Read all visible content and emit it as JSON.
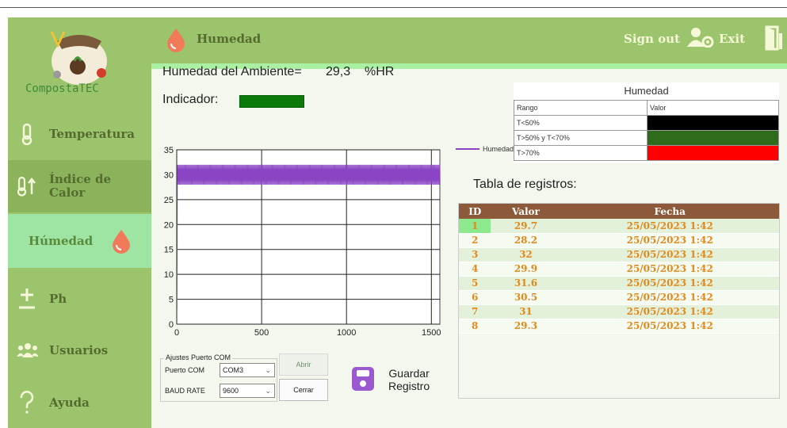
{
  "app": {
    "name": "CompostaTEC"
  },
  "header": {
    "title": "Humedad",
    "sign_out": "Sign out",
    "exit": "Exit"
  },
  "sidebar": {
    "items": [
      {
        "label": "Temperatura",
        "icon": "thermometer-icon"
      },
      {
        "label": "Índice de Calor",
        "line1": "Índice de",
        "line2": "Calor",
        "icon": "heat-index-icon"
      },
      {
        "label": "Húmedad",
        "icon": "water-drop-icon"
      },
      {
        "label": "Ph",
        "icon": "plus-minus-icon"
      },
      {
        "label": "Usuarios",
        "icon": "users-icon"
      },
      {
        "label": "Ayuda",
        "icon": "question-icon"
      }
    ]
  },
  "main": {
    "humidity_label": "Humedad del Ambiente=",
    "humidity_value": "29,3",
    "humidity_unit": "%HR",
    "indicator_label": "Indicador:",
    "indicator_color": "#0b7a0b"
  },
  "reference": {
    "title": "Humedad",
    "headers": [
      "Rango",
      "Valor"
    ],
    "rows": [
      {
        "range": "T<50%",
        "color": "#000000"
      },
      {
        "range": "T>50% y T<70%",
        "color": "#2e6b1a"
      },
      {
        "range": "T>70%",
        "color": "#ff0000"
      }
    ]
  },
  "chart_data": {
    "type": "line",
    "series": [
      {
        "name": "Humedad",
        "color": "#8a44c4"
      }
    ],
    "xlim": [
      0,
      1550
    ],
    "ylim": [
      0,
      35
    ],
    "xticks": [
      "0",
      "500",
      "1000",
      "1500"
    ],
    "yticks": [
      "0",
      "5",
      "10",
      "15",
      "20",
      "25",
      "30",
      "35"
    ],
    "grid": true,
    "legend": "right",
    "oscillation_range": [
      28,
      32
    ]
  },
  "records": {
    "title": "Tabla de registros:",
    "headers": [
      "ID",
      "Valor",
      "Fecha"
    ],
    "rows": [
      [
        "1",
        "29.7",
        "25/05/2023 1:42"
      ],
      [
        "2",
        "28.2",
        "25/05/2023 1:42"
      ],
      [
        "3",
        "32",
        "25/05/2023 1:42"
      ],
      [
        "4",
        "29.9",
        "25/05/2023 1:42"
      ],
      [
        "5",
        "31.6",
        "25/05/2023 1:42"
      ],
      [
        "6",
        "30.5",
        "25/05/2023 1:42"
      ],
      [
        "7",
        "31",
        "25/05/2023 1:42"
      ],
      [
        "8",
        "29.3",
        "25/05/2023 1:42"
      ]
    ]
  },
  "com": {
    "title": "Ajustes Puerto COM",
    "port_label": "Puerto COM",
    "port_value": "COM3",
    "baud_label": "BAUD RATE",
    "baud_value": "9600",
    "open_label": "Abrir",
    "close_label": "Cerrar"
  },
  "save": {
    "line1": "Guardar",
    "line2": "Registro"
  }
}
